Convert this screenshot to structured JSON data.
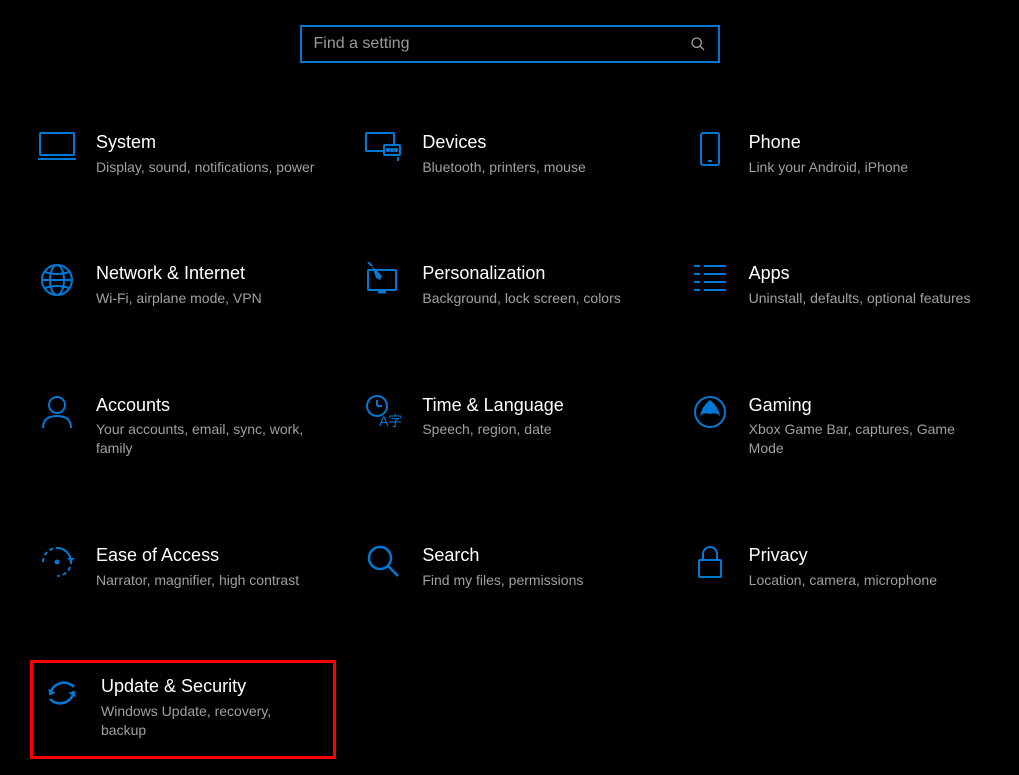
{
  "search": {
    "placeholder": "Find a setting"
  },
  "tiles": [
    {
      "title": "System",
      "desc": "Display, sound, notifications, power"
    },
    {
      "title": "Devices",
      "desc": "Bluetooth, printers, mouse"
    },
    {
      "title": "Phone",
      "desc": "Link your Android, iPhone"
    },
    {
      "title": "Network & Internet",
      "desc": "Wi-Fi, airplane mode, VPN"
    },
    {
      "title": "Personalization",
      "desc": "Background, lock screen, colors"
    },
    {
      "title": "Apps",
      "desc": "Uninstall, defaults, optional features"
    },
    {
      "title": "Accounts",
      "desc": "Your accounts, email, sync, work, family"
    },
    {
      "title": "Time & Language",
      "desc": "Speech, region, date"
    },
    {
      "title": "Gaming",
      "desc": "Xbox Game Bar, captures, Game Mode"
    },
    {
      "title": "Ease of Access",
      "desc": "Narrator, magnifier, high contrast"
    },
    {
      "title": "Search",
      "desc": "Find my files, permissions"
    },
    {
      "title": "Privacy",
      "desc": "Location, camera, microphone"
    },
    {
      "title": "Update & Security",
      "desc": "Windows Update, recovery, backup"
    }
  ],
  "colors": {
    "accent": "#0078d4",
    "highlight": "#ff0000"
  }
}
